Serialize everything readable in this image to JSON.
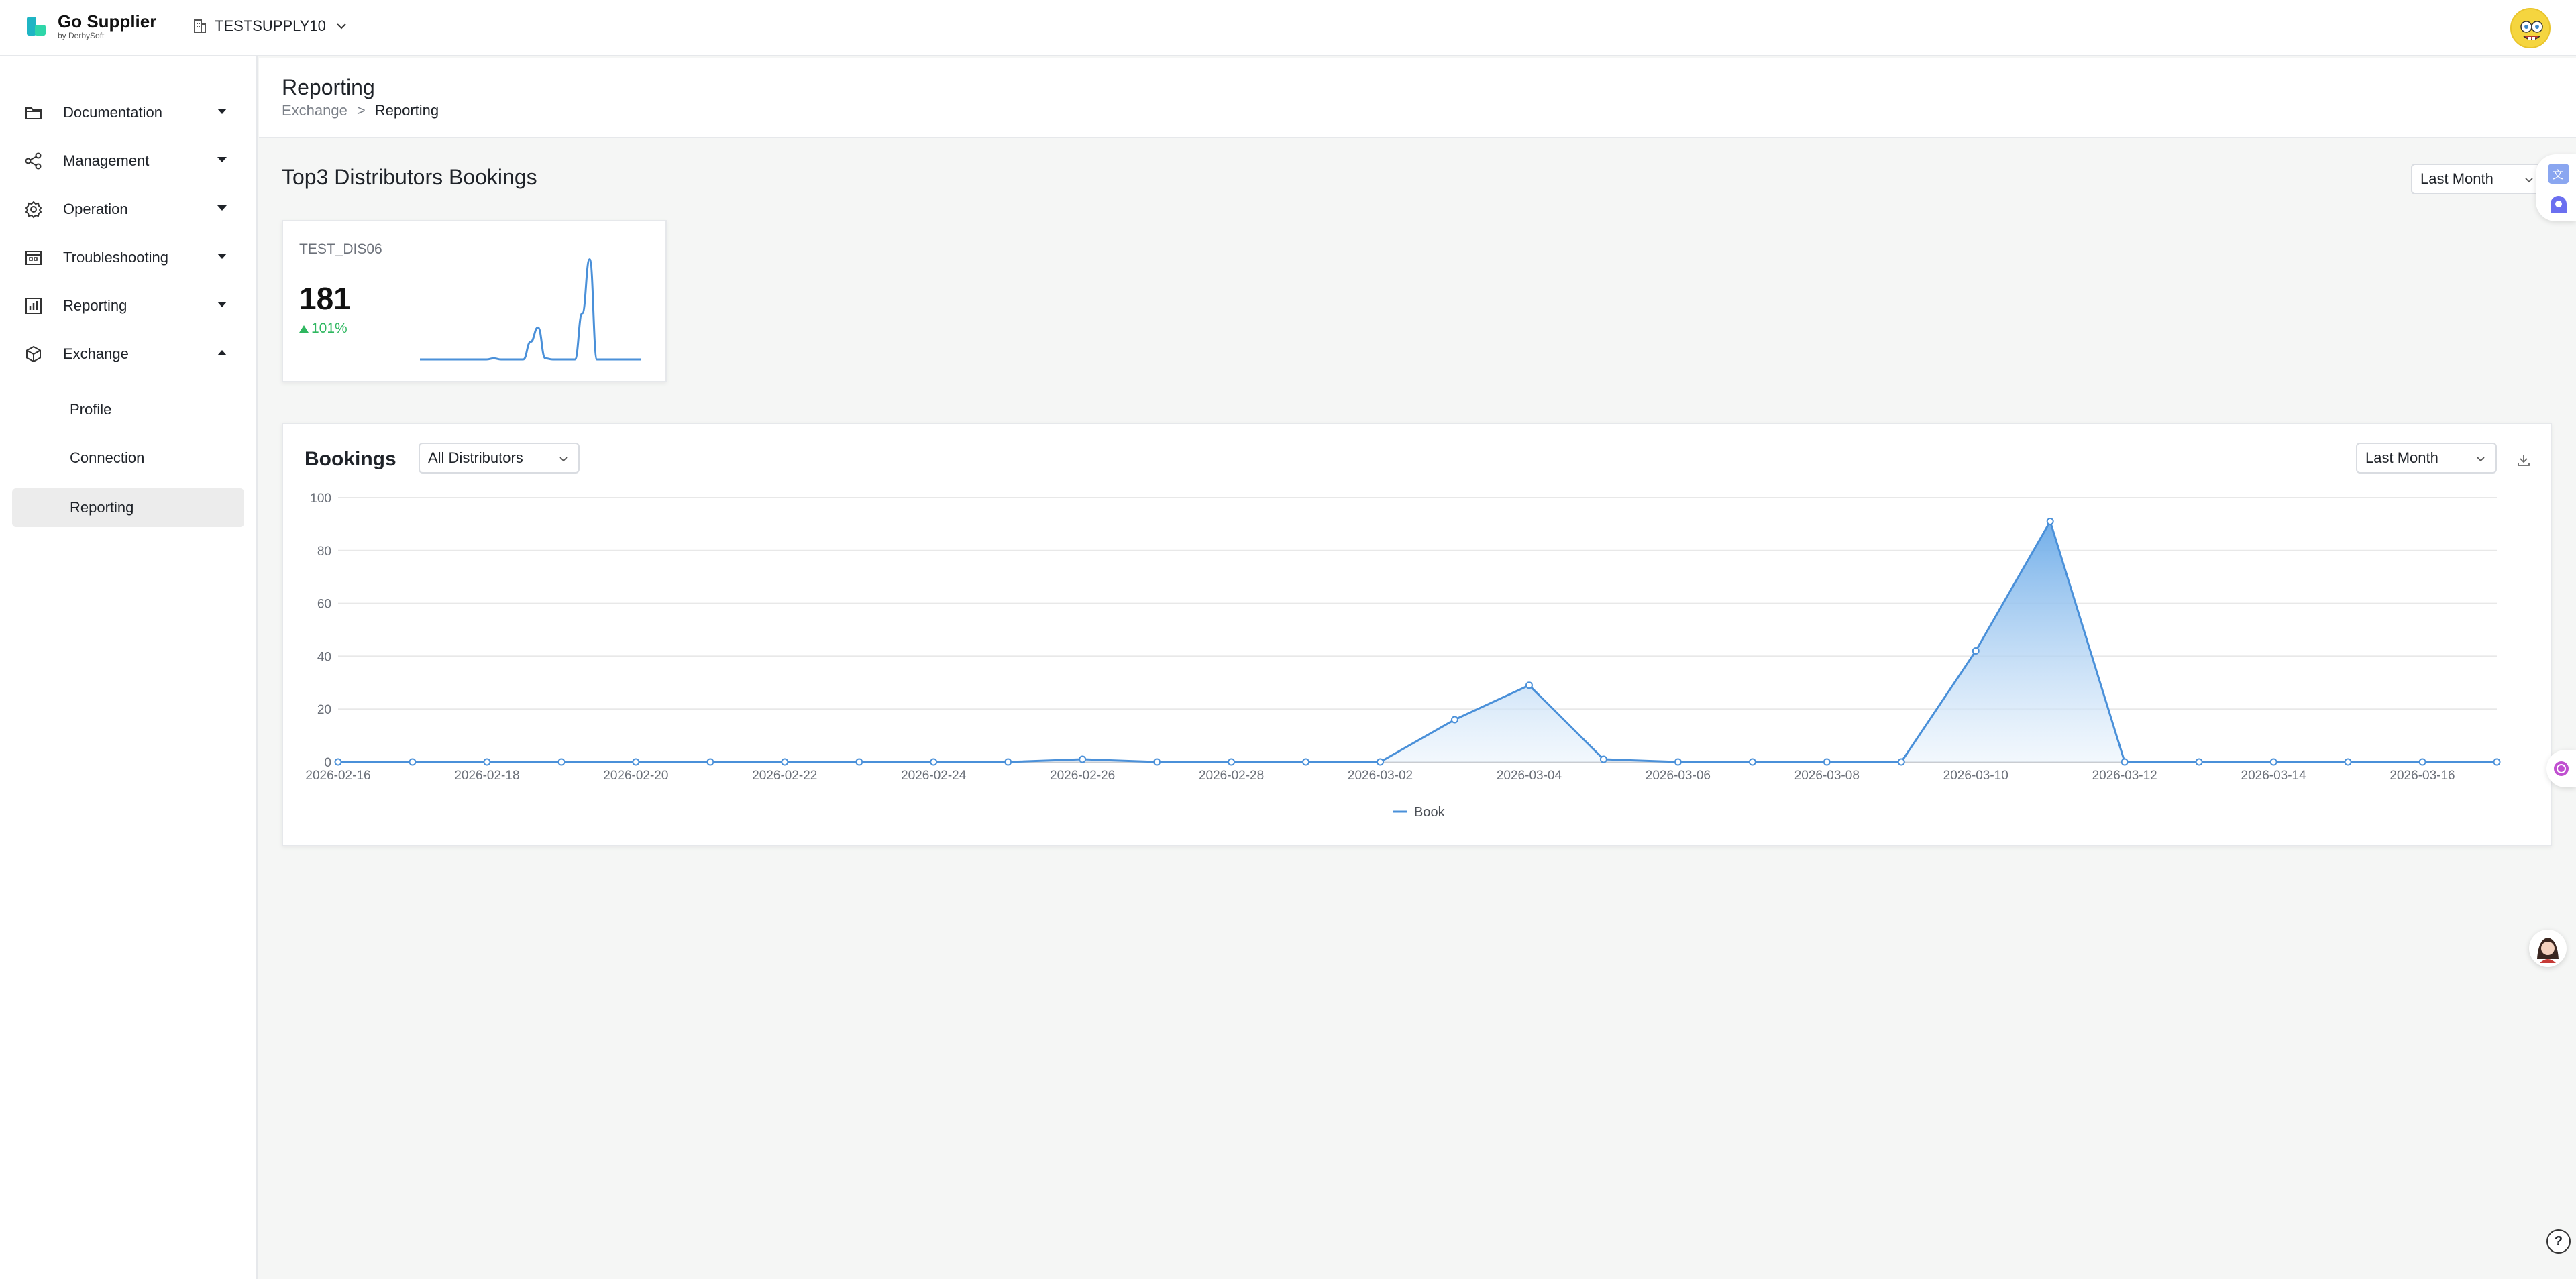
{
  "app": {
    "name": "Go Supplier",
    "byline": "by DerbySoft",
    "tenant": "TESTSUPPLY10"
  },
  "sidebar": {
    "items": [
      {
        "label": "Documentation",
        "icon": "folder-icon",
        "expanded": false
      },
      {
        "label": "Management",
        "icon": "share-nodes-icon",
        "expanded": false
      },
      {
        "label": "Operation",
        "icon": "gear-icon",
        "expanded": false
      },
      {
        "label": "Troubleshooting",
        "icon": "calendar-bug-icon",
        "expanded": false
      },
      {
        "label": "Reporting",
        "icon": "report-chart-icon",
        "expanded": false
      },
      {
        "label": "Exchange",
        "icon": "cube-icon",
        "expanded": true
      }
    ],
    "exchange_children": [
      {
        "label": "Profile",
        "active": false
      },
      {
        "label": "Connection",
        "active": false
      },
      {
        "label": "Reporting",
        "active": true
      }
    ]
  },
  "header": {
    "title": "Reporting",
    "breadcrumb": [
      "Exchange",
      "Reporting"
    ],
    "breadcrumb_sep": ">"
  },
  "top3": {
    "title": "Top3 Distributors Bookings",
    "period": "Last Month",
    "cards": [
      {
        "distributor": "TEST_DIS06",
        "value": "181",
        "delta": "101%",
        "spark": [
          0,
          0,
          0,
          0,
          0,
          0,
          0,
          0,
          0,
          0,
          1,
          0,
          0,
          0,
          0,
          16,
          29,
          1,
          0,
          0,
          0,
          0,
          42,
          91,
          0,
          0,
          0,
          0,
          0,
          0,
          0
        ]
      }
    ]
  },
  "bookings": {
    "title": "Bookings",
    "distributor_filter": "All Distributors",
    "period": "Last Month",
    "colors": {
      "line": "#4a90d9",
      "fill_top": "#6aaae8",
      "fill_bottom": "#eaf3fc",
      "grid": "#e8e8e8"
    }
  },
  "chart_data": {
    "type": "area",
    "x": [
      "2026-02-16",
      "2026-02-17",
      "2026-02-18",
      "2026-02-19",
      "2026-02-20",
      "2026-02-21",
      "2026-02-22",
      "2026-02-23",
      "2026-02-24",
      "2026-02-25",
      "2026-02-26",
      "2026-02-27",
      "2026-02-28",
      "2026-03-01",
      "2026-03-02",
      "2026-03-03",
      "2026-03-04",
      "2026-03-05",
      "2026-03-06",
      "2026-03-07",
      "2026-03-08",
      "2026-03-09",
      "2026-03-10",
      "2026-03-11",
      "2026-03-12",
      "2026-03-13",
      "2026-03-14",
      "2026-03-15",
      "2026-03-16",
      "2026-03-17"
    ],
    "x_tick_labels": [
      "2026-02-16",
      "2026-02-18",
      "2026-02-20",
      "2026-02-22",
      "2026-02-24",
      "2026-02-26",
      "2026-02-28",
      "2026-03-02",
      "2026-03-04",
      "2026-03-06",
      "2026-03-08",
      "2026-03-10",
      "2026-03-12",
      "2026-03-14",
      "2026-03-16"
    ],
    "series": [
      {
        "name": "Book",
        "values": [
          0,
          0,
          0,
          0,
          0,
          0,
          0,
          0,
          0,
          0,
          1,
          0,
          0,
          0,
          0,
          16,
          29,
          1,
          0,
          0,
          0,
          0,
          42,
          91,
          0,
          0,
          0,
          0,
          0,
          0
        ]
      }
    ],
    "ylim": [
      0,
      100
    ],
    "y_ticks": [
      0,
      20,
      40,
      60,
      80,
      100
    ],
    "grid": true,
    "legend": "bottom-center"
  }
}
